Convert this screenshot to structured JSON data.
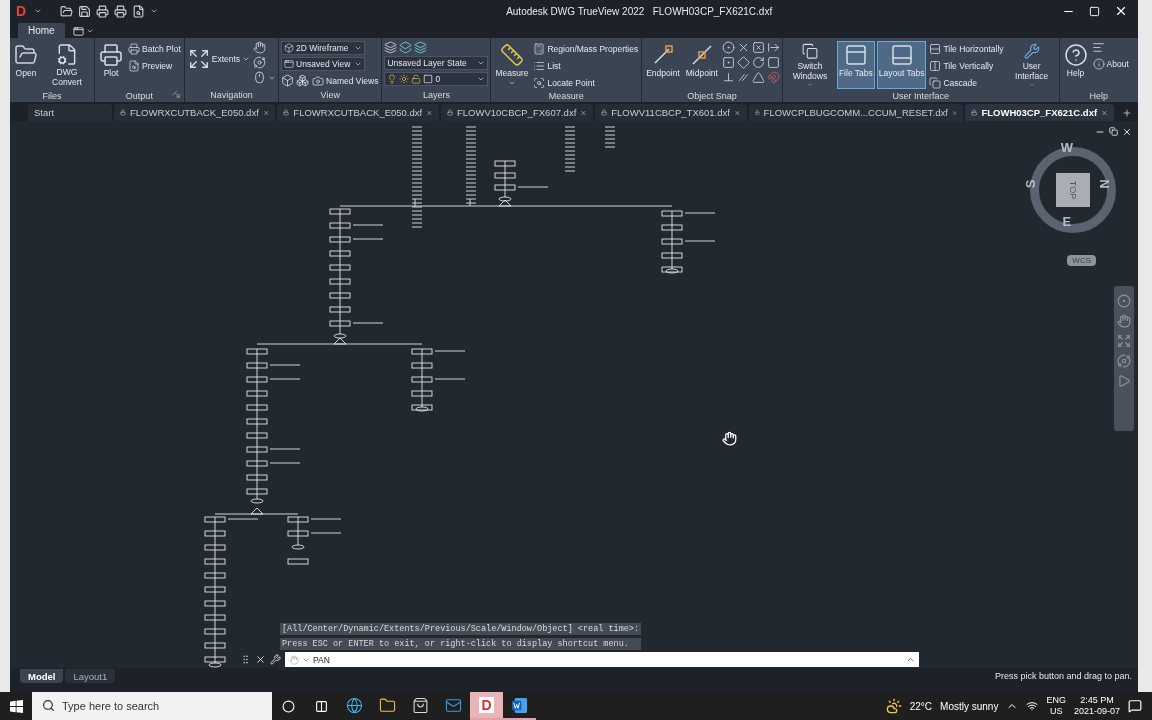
{
  "title_bar": {
    "logo": "D",
    "app_name": "Autodesk DWG TrueView 2022",
    "file_name": "FLOWH03CP_FX621C.dxf"
  },
  "ribbon_tabs": [
    {
      "label": "Home",
      "selected": true
    }
  ],
  "ribbon_panels": [
    {
      "title": "Files",
      "columns": [
        [
          {
            "kind": "large",
            "label": "Open"
          }
        ],
        [
          {
            "kind": "large",
            "label": "DWG Convert"
          }
        ]
      ]
    },
    {
      "title": "Output",
      "launcher": true,
      "columns": [
        [
          {
            "kind": "large",
            "label": "Plot"
          }
        ],
        [
          {
            "kind": "small",
            "label": "Batch Plot"
          },
          {
            "kind": "small",
            "label": "Preview"
          }
        ]
      ]
    },
    {
      "title": "Navigation",
      "columns": [
        [
          {
            "kind": "wide",
            "label": "Extents",
            "caret": true
          }
        ],
        [
          {
            "kind": "tool"
          },
          {
            "kind": "tool"
          },
          {
            "kind": "tool",
            "caret": true
          }
        ]
      ]
    },
    {
      "title": "View",
      "columns": [
        [
          {
            "kind": "dropdown",
            "value": "2D Wireframe"
          },
          {
            "kind": "dropdown",
            "value": "Unsaved View"
          },
          {
            "kind": "row",
            "items": [
              {
                "kind": "tool"
              },
              {
                "kind": "tool"
              },
              {
                "kind": "small",
                "label": "Named Views"
              }
            ]
          }
        ]
      ]
    },
    {
      "title": "Layers",
      "columns": [
        [
          {
            "kind": "row",
            "items": [
              {
                "kind": "tool"
              },
              {
                "kind": "tool"
              },
              {
                "kind": "tool"
              }
            ]
          },
          {
            "kind": "dropdown",
            "value": "Unsaved Layer State"
          },
          {
            "kind": "dropdown",
            "value": "0"
          }
        ]
      ]
    },
    {
      "title": "Measure",
      "columns": [
        [
          {
            "kind": "large",
            "label": "Measure",
            "caret": true
          }
        ],
        [
          {
            "kind": "small",
            "label": "Region/Mass Properties"
          },
          {
            "kind": "small",
            "label": "List"
          },
          {
            "kind": "small",
            "label": "Locate Point"
          }
        ]
      ]
    },
    {
      "title": "Object Snap",
      "columns": [
        [
          {
            "kind": "large",
            "label": "Endpoint"
          }
        ],
        [
          {
            "kind": "large",
            "label": "Midpoint"
          }
        ],
        [
          {
            "kind": "row",
            "items": [
              {
                "kind": "tool"
              },
              {
                "kind": "tool"
              },
              {
                "kind": "tool"
              },
              {
                "kind": "tool"
              }
            ]
          },
          {
            "kind": "row",
            "items": [
              {
                "kind": "tool"
              },
              {
                "kind": "tool"
              },
              {
                "kind": "tool"
              },
              {
                "kind": "tool"
              }
            ]
          },
          {
            "kind": "row",
            "items": [
              {
                "kind": "tool"
              },
              {
                "kind": "tool"
              },
              {
                "kind": "tool"
              },
              {
                "kind": "tool"
              }
            ]
          }
        ]
      ]
    },
    {
      "title": "User Interface",
      "columns": [
        [
          {
            "kind": "large",
            "label": "Switch Windows",
            "caret": true
          }
        ],
        [
          {
            "kind": "large",
            "label": "File Tabs",
            "on": true
          }
        ],
        [
          {
            "kind": "large",
            "label": "Layout Tabs",
            "on": true
          }
        ],
        [
          {
            "kind": "small",
            "label": "Tile Horizontally"
          },
          {
            "kind": "small",
            "label": "Tile Vertically"
          },
          {
            "kind": "small",
            "label": "Cascade"
          }
        ],
        [
          {
            "kind": "large",
            "label": "User Interface",
            "caret": true
          }
        ]
      ]
    },
    {
      "title": "Help",
      "columns": [
        [
          {
            "kind": "large",
            "label": "Help"
          }
        ],
        [
          {
            "kind": "tool"
          },
          {
            "kind": "small",
            "label": "About"
          }
        ]
      ]
    }
  ],
  "file_tabs": [
    {
      "kind": "start",
      "label": "Start",
      "selected": false
    },
    {
      "kind": "file",
      "label": "FLOWRXCUTBACK_E050.dxf",
      "selected": false
    },
    {
      "kind": "file",
      "label": "FLOWRXCUTBACK_E050.dxf",
      "selected": false
    },
    {
      "kind": "file",
      "label": "FLOWV10CBCP_FX607.dxf",
      "selected": false
    },
    {
      "kind": "file",
      "label": "FLOWV11CBCP_TX601.dxf",
      "selected": false
    },
    {
      "kind": "file",
      "label": "FLOWCPLBUGCOMM...CCUM_RESET.dxf",
      "selected": false
    },
    {
      "kind": "file",
      "label": "FLOWH03CP_FX621C.dxf",
      "selected": true
    }
  ],
  "viewcube": {
    "directions": [
      "W",
      "N",
      "E",
      "S"
    ],
    "face": "TOP",
    "ucs": "WCS"
  },
  "command_history": [
    "[All/Center/Dynamic/Extents/Previous/Scale/Window/Object] <real time>:",
    "Press ESC or ENTER to exit, or right-click to display shortcut menu."
  ],
  "command_line": {
    "value": "PAN"
  },
  "layout_tabs": [
    {
      "label": "Model",
      "selected": true
    },
    {
      "label": "Layout1",
      "selected": false
    }
  ],
  "status_message": "Press pick button and drag to pan.",
  "taskbar": {
    "search": {
      "placeholder": "Type here to search"
    },
    "apps": [
      {
        "selected": false,
        "running": false
      },
      {
        "selected": false,
        "running": false
      },
      {
        "selected": false,
        "running": false
      },
      {
        "selected": false,
        "running": false
      },
      {
        "label": "D",
        "selected": true,
        "running": true
      },
      {
        "selected": false,
        "running": true
      }
    ],
    "weather": {
      "temperature": "22°C",
      "condition": "Mostly sunny"
    },
    "language": [
      "ENG",
      "US"
    ],
    "time": "2:45 PM",
    "date": "2021-09-07"
  }
}
